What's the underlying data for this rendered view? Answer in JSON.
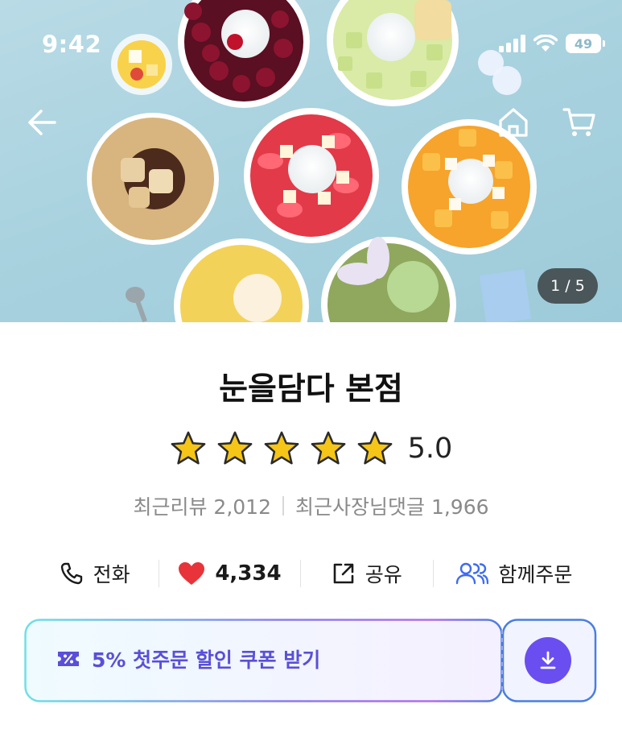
{
  "status_bar": {
    "time": "9:42",
    "battery": "49",
    "icons": [
      "cellular-signal-icon",
      "wifi-icon",
      "battery-icon"
    ]
  },
  "hero": {
    "page_counter": "1 / 5",
    "nav_icons": [
      "back-arrow-icon",
      "home-icon",
      "cart-icon"
    ]
  },
  "store": {
    "name": "눈을담다 본점",
    "rating": "5.0",
    "star_count": 5,
    "recent_reviews": "최근리뷰 2,012",
    "owner_replies": "최근사장님댓글 1,966"
  },
  "actions": {
    "call_label": "전화",
    "likes_count": "4,334",
    "share_label": "공유",
    "group_order_label": "함께주문"
  },
  "coupon": {
    "label": "5% 첫주문 할인 쿠폰 받기"
  },
  "colors": {
    "accent_purple": "#6a4ef0",
    "coupon_text": "#5a4fd9",
    "heart_red": "#e8333a",
    "group_icon_blue": "#3d6cf2",
    "star_gold": "#f5c518"
  }
}
